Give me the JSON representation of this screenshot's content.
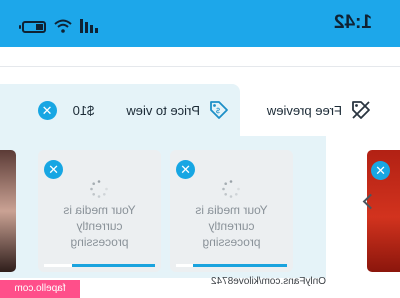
{
  "status_bar": {
    "time": "1:42",
    "battery_level": 0.35
  },
  "tabs": {
    "free_preview": {
      "label": "Free preview",
      "icon": "tag-off-icon"
    },
    "price_to_view": {
      "label": "Price to view",
      "icon": "price-tag-icon",
      "amount": "$10"
    }
  },
  "media_cards": [
    {
      "message": "Your media is currently processing",
      "progress": 0.75
    },
    {
      "message": "Your media is currently processing",
      "progress": 0.85
    }
  ],
  "watermark": "OnlyFans.com/kilove8742",
  "site_badge": "fapello.com",
  "colors": {
    "accent": "#1da7ea",
    "panel": "#e5f3f8",
    "badge": "#ff4f8a"
  }
}
